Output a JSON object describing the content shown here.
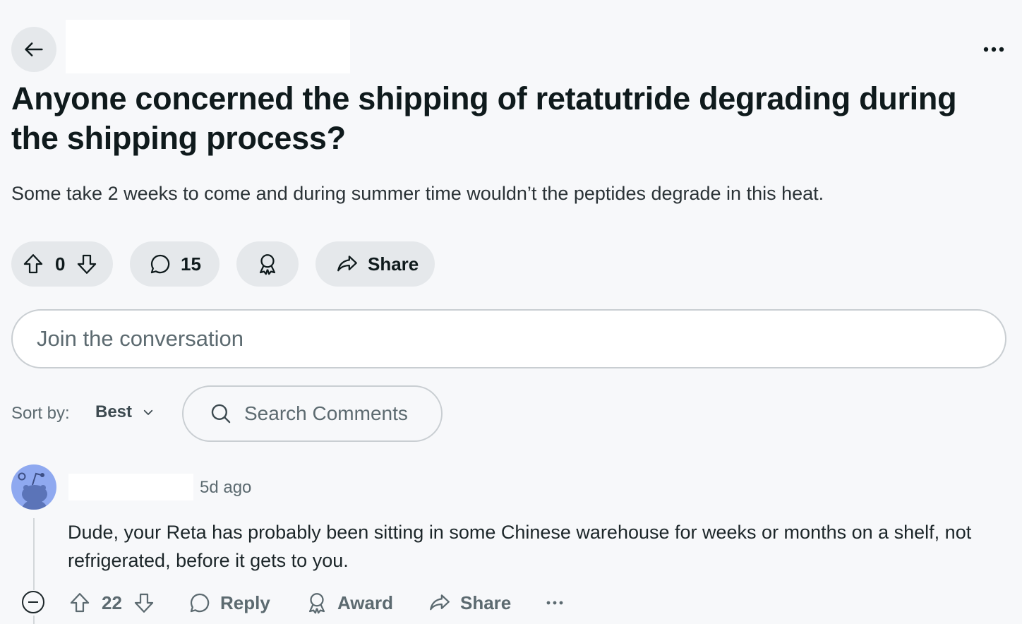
{
  "header": {
    "back_icon": "arrow-left-icon",
    "more_icon": "more-horizontal-icon"
  },
  "post": {
    "title": "Anyone concerned the shipping of retatutride degrading during the shipping process?",
    "body": "Some take 2 weeks to come and during summer time wouldn’t the peptides degrade in this heat.",
    "vote_count": "0",
    "comment_count": "15",
    "share_label": "Share"
  },
  "composer": {
    "placeholder": "Join the conversation"
  },
  "sort": {
    "label": "Sort by:",
    "selected": "Best",
    "search_placeholder": "Search Comments"
  },
  "comments": [
    {
      "time": "5d ago",
      "text": "Dude, your Reta has probably been sitting in some Chinese warehouse for weeks or months on a shelf, not refrigerated, before it gets to you.",
      "score": "22",
      "reply_label": "Reply",
      "award_label": "Award",
      "share_label": "Share"
    }
  ],
  "colors": {
    "background": "#f7f8fa",
    "pill": "#e5e8eb",
    "avatar": "#8fa9f0",
    "muted_text": "#5c6a70"
  }
}
